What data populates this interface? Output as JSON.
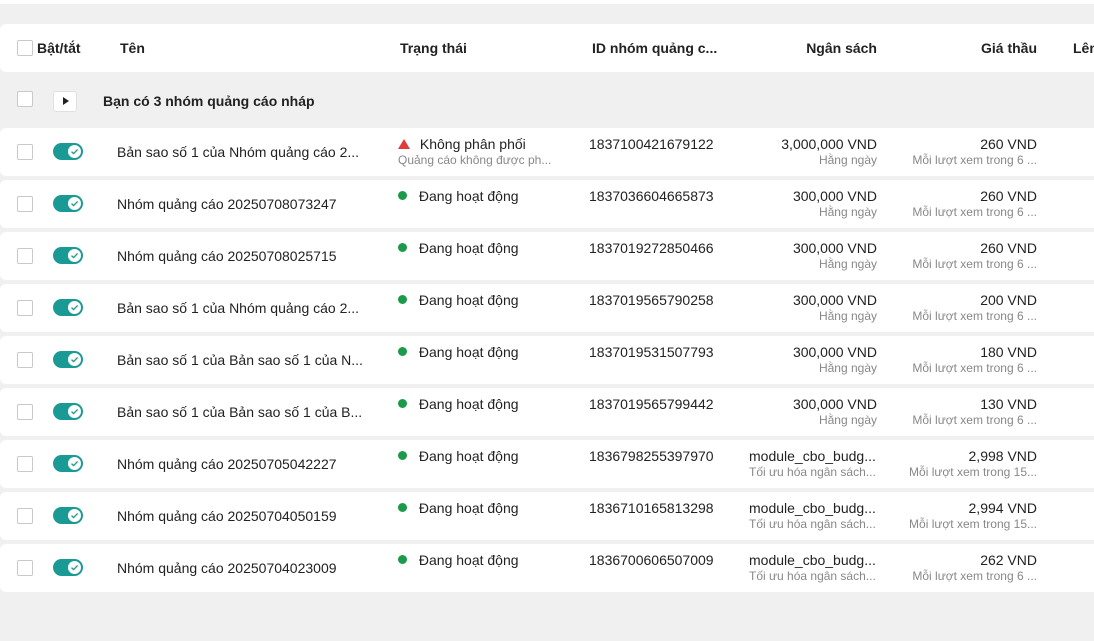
{
  "header": {
    "toggle_label": "Bật/tắt",
    "name_label": "Tên",
    "status_label": "Trạng thái",
    "id_label": "ID nhóm quảng c...",
    "budget_label": "Ngân sách",
    "bid_label": "Giá thầu",
    "extra_label": "Lên"
  },
  "draft": {
    "text": "Bạn có 3 nhóm quảng cáo nháp"
  },
  "rows": [
    {
      "name": "Bản sao số 1 của Nhóm quảng cáo 2...",
      "status": "Không phân phối",
      "status_sub": "Quảng cáo không được ph...",
      "id": "1837100421679122",
      "budget": "3,000,000 VND",
      "budget_sub": "Hằng ngày",
      "bid": "260 VND",
      "bid_sub": "Mỗi lượt xem trong 6 ..."
    },
    {
      "name": "Nhóm quảng cáo 20250708073247",
      "status": "Đang hoạt động",
      "id": "1837036604665873",
      "budget": "300,000 VND",
      "budget_sub": "Hằng ngày",
      "bid": "260 VND",
      "bid_sub": "Mỗi lượt xem trong 6 ..."
    },
    {
      "name": "Nhóm quảng cáo 20250708025715",
      "status": "Đang hoạt động",
      "id": "1837019272850466",
      "budget": "300,000 VND",
      "budget_sub": "Hằng ngày",
      "bid": "260 VND",
      "bid_sub": "Mỗi lượt xem trong 6 ..."
    },
    {
      "name": "Bản sao số 1 của Nhóm quảng cáo 2...",
      "status": "Đang hoạt động",
      "id": "1837019565790258",
      "budget": "300,000 VND",
      "budget_sub": "Hằng ngày",
      "bid": "200 VND",
      "bid_sub": "Mỗi lượt xem trong 6 ..."
    },
    {
      "name": "Bản sao số 1 của Bản sao số 1 của N...",
      "status": "Đang hoạt động",
      "id": "1837019531507793",
      "budget": "300,000 VND",
      "budget_sub": "Hằng ngày",
      "bid": "180 VND",
      "bid_sub": "Mỗi lượt xem trong 6 ..."
    },
    {
      "name": "Bản sao số 1 của Bản sao số 1 của B...",
      "status": "Đang hoạt động",
      "id": "1837019565799442",
      "budget": "300,000 VND",
      "budget_sub": "Hằng ngày",
      "bid": "130 VND",
      "bid_sub": "Mỗi lượt xem trong 6 ..."
    },
    {
      "name": "Nhóm quảng cáo 20250705042227",
      "status": "Đang hoạt động",
      "id": "1836798255397970",
      "budget": "module_cbo_budg...",
      "budget_sub": "Tối ưu hóa ngân sách...",
      "bid": "2,998 VND",
      "bid_sub": "Mỗi lượt xem trong 15..."
    },
    {
      "name": "Nhóm quảng cáo 20250704050159",
      "status": "Đang hoạt động",
      "id": "1836710165813298",
      "budget": "module_cbo_budg...",
      "budget_sub": "Tối ưu hóa ngân sách...",
      "bid": "2,994 VND",
      "bid_sub": "Mỗi lượt xem trong 15..."
    },
    {
      "name": "Nhóm quảng cáo 20250704023009",
      "status": "Đang hoạt động",
      "id": "1836700606507009",
      "budget": "module_cbo_budg...",
      "budget_sub": "Tối ưu hóa ngân sách...",
      "bid": "262 VND",
      "bid_sub": "Mỗi lượt xem trong 6 ..."
    }
  ],
  "colors": {
    "toggle_on": "#1a9a94",
    "status_active": "#1a9a4a",
    "status_warning": "#e23b3b"
  }
}
